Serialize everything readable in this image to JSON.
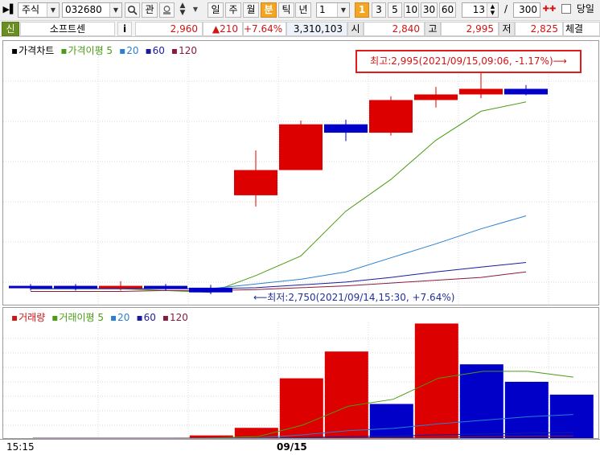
{
  "toolbar": {
    "market": "주식",
    "code": "032680",
    "btn_gwan": "관",
    "periods": [
      "일",
      "주",
      "월",
      "분",
      "틱",
      "년"
    ],
    "active_period": "분",
    "interval": "1",
    "minute_presets": [
      "1",
      "3",
      "5",
      "10",
      "30",
      "60"
    ],
    "active_preset": "1",
    "count_value": "13",
    "slash": "/",
    "max_value": "300",
    "today_label": "당일"
  },
  "info": {
    "badge": "신",
    "name": "소프트센",
    "info_button": "i",
    "price": "2,960",
    "change": "▲210",
    "change_rate": "+7.64%",
    "volume": "3,310,103",
    "open_label": "시",
    "open": "2,840",
    "high_label": "고",
    "high": "2,995",
    "low_label": "저",
    "low": "2,825",
    "trade_label": "체결"
  },
  "price_panel": {
    "legend": [
      {
        "label": "가격차트",
        "color": "#000000"
      },
      {
        "label": "가격이평 5",
        "color": "#4a9c14"
      },
      {
        "label": "20",
        "color": "#2a7fd1"
      },
      {
        "label": "60",
        "color": "#1a1a9e"
      },
      {
        "label": "120",
        "color": "#8a1a3a"
      }
    ],
    "high_note": "최고:2,995(2021/09/15,09:06, -1.17%)⟶",
    "low_note": "⟵최저:2,750(2021/09/14,15:30, +7.64%)"
  },
  "volume_panel": {
    "legend": [
      {
        "label": "거래량",
        "color": "#d21414"
      },
      {
        "label": "거래이평 5",
        "color": "#4a9c14"
      },
      {
        "label": "20",
        "color": "#2a7fd1"
      },
      {
        "label": "60",
        "color": "#1a1a9e"
      },
      {
        "label": "120",
        "color": "#8a1a3a"
      }
    ]
  },
  "xaxis": {
    "left_label": "15:15",
    "date_label": "09/15"
  },
  "colors": {
    "up": "#dd0000",
    "down": "#0000c8",
    "ma5": "#4a9c14",
    "ma20": "#2a7fd1",
    "ma60": "#1a1a9e",
    "ma120": "#8a1a3a",
    "note_border": "#e01b1b"
  },
  "chart_data": [
    {
      "type": "candlestick",
      "title": "가격차트",
      "ylim": [
        2740,
        3000
      ],
      "candles": [
        {
          "open": 2755,
          "close": 2755,
          "high": 2757,
          "low": 2750,
          "dir": "down"
        },
        {
          "open": 2755,
          "close": 2755,
          "high": 2757,
          "low": 2750,
          "dir": "down"
        },
        {
          "open": 2755,
          "close": 2755,
          "high": 2760,
          "low": 2750,
          "dir": "up"
        },
        {
          "open": 2755,
          "close": 2752,
          "high": 2757,
          "low": 2750,
          "dir": "down"
        },
        {
          "open": 2753,
          "close": 2748,
          "high": 2756,
          "low": 2746,
          "dir": "down"
        },
        {
          "open": 2852,
          "close": 2879,
          "high": 2900,
          "low": 2840,
          "dir": "up"
        },
        {
          "open": 2879,
          "close": 2928,
          "high": 2932,
          "low": 2879,
          "dir": "up"
        },
        {
          "open": 2928,
          "close": 2919,
          "high": 2933,
          "low": 2910,
          "dir": "down"
        },
        {
          "open": 2919,
          "close": 2954,
          "high": 2958,
          "low": 2916,
          "dir": "up"
        },
        {
          "open": 2954,
          "close": 2960,
          "high": 2968,
          "low": 2946,
          "dir": "up"
        },
        {
          "open": 2960,
          "close": 2966,
          "high": 2995,
          "low": 2956,
          "dir": "up"
        },
        {
          "open": 2966,
          "close": 2960,
          "high": 2970,
          "low": 2959,
          "dir": "down"
        }
      ],
      "series": [
        {
          "name": "가격이평 5",
          "values": [
            2752,
            2752,
            2752,
            2750,
            2748,
            2766,
            2787,
            2835,
            2869,
            2911,
            2942,
            2952
          ]
        },
        {
          "name": "20",
          "values": [
            2752,
            2752,
            2752,
            2752,
            2752,
            2757,
            2762,
            2770,
            2785,
            2800,
            2816,
            2830
          ]
        },
        {
          "name": "60",
          "values": [
            2752,
            2752,
            2752,
            2752,
            2752,
            2753,
            2756,
            2759,
            2764,
            2770,
            2775,
            2780
          ]
        },
        {
          "name": "120",
          "values": [
            2749,
            2749,
            2749,
            2750,
            2750,
            2751,
            2753,
            2755,
            2758,
            2761,
            2764,
            2770
          ]
        }
      ]
    },
    {
      "type": "bar",
      "title": "거래량",
      "ylim": [
        0,
        1000
      ],
      "values": [
        5,
        5,
        5,
        5,
        30,
        95,
        520,
        750,
        300,
        990,
        640,
        490,
        380
      ],
      "dirs": [
        "down",
        "down",
        "up",
        "down",
        "up",
        "up",
        "up",
        "up",
        "down",
        "up",
        "down",
        "down",
        "down"
      ],
      "series": [
        {
          "name": "거래이평 5",
          "values": [
            5,
            5,
            5,
            5,
            10,
            20,
            120,
            280,
            340,
            520,
            580,
            580,
            530
          ]
        },
        {
          "name": "20",
          "values": [
            5,
            5,
            5,
            5,
            6,
            10,
            35,
            70,
            90,
            130,
            160,
            190,
            210
          ]
        },
        {
          "name": "60",
          "values": [
            5,
            5,
            5,
            5,
            5,
            6,
            12,
            20,
            25,
            35,
            42,
            50,
            55
          ]
        },
        {
          "name": "120",
          "values": [
            5,
            5,
            5,
            5,
            5,
            5,
            7,
            10,
            12,
            16,
            20,
            24,
            26
          ]
        }
      ]
    }
  ]
}
